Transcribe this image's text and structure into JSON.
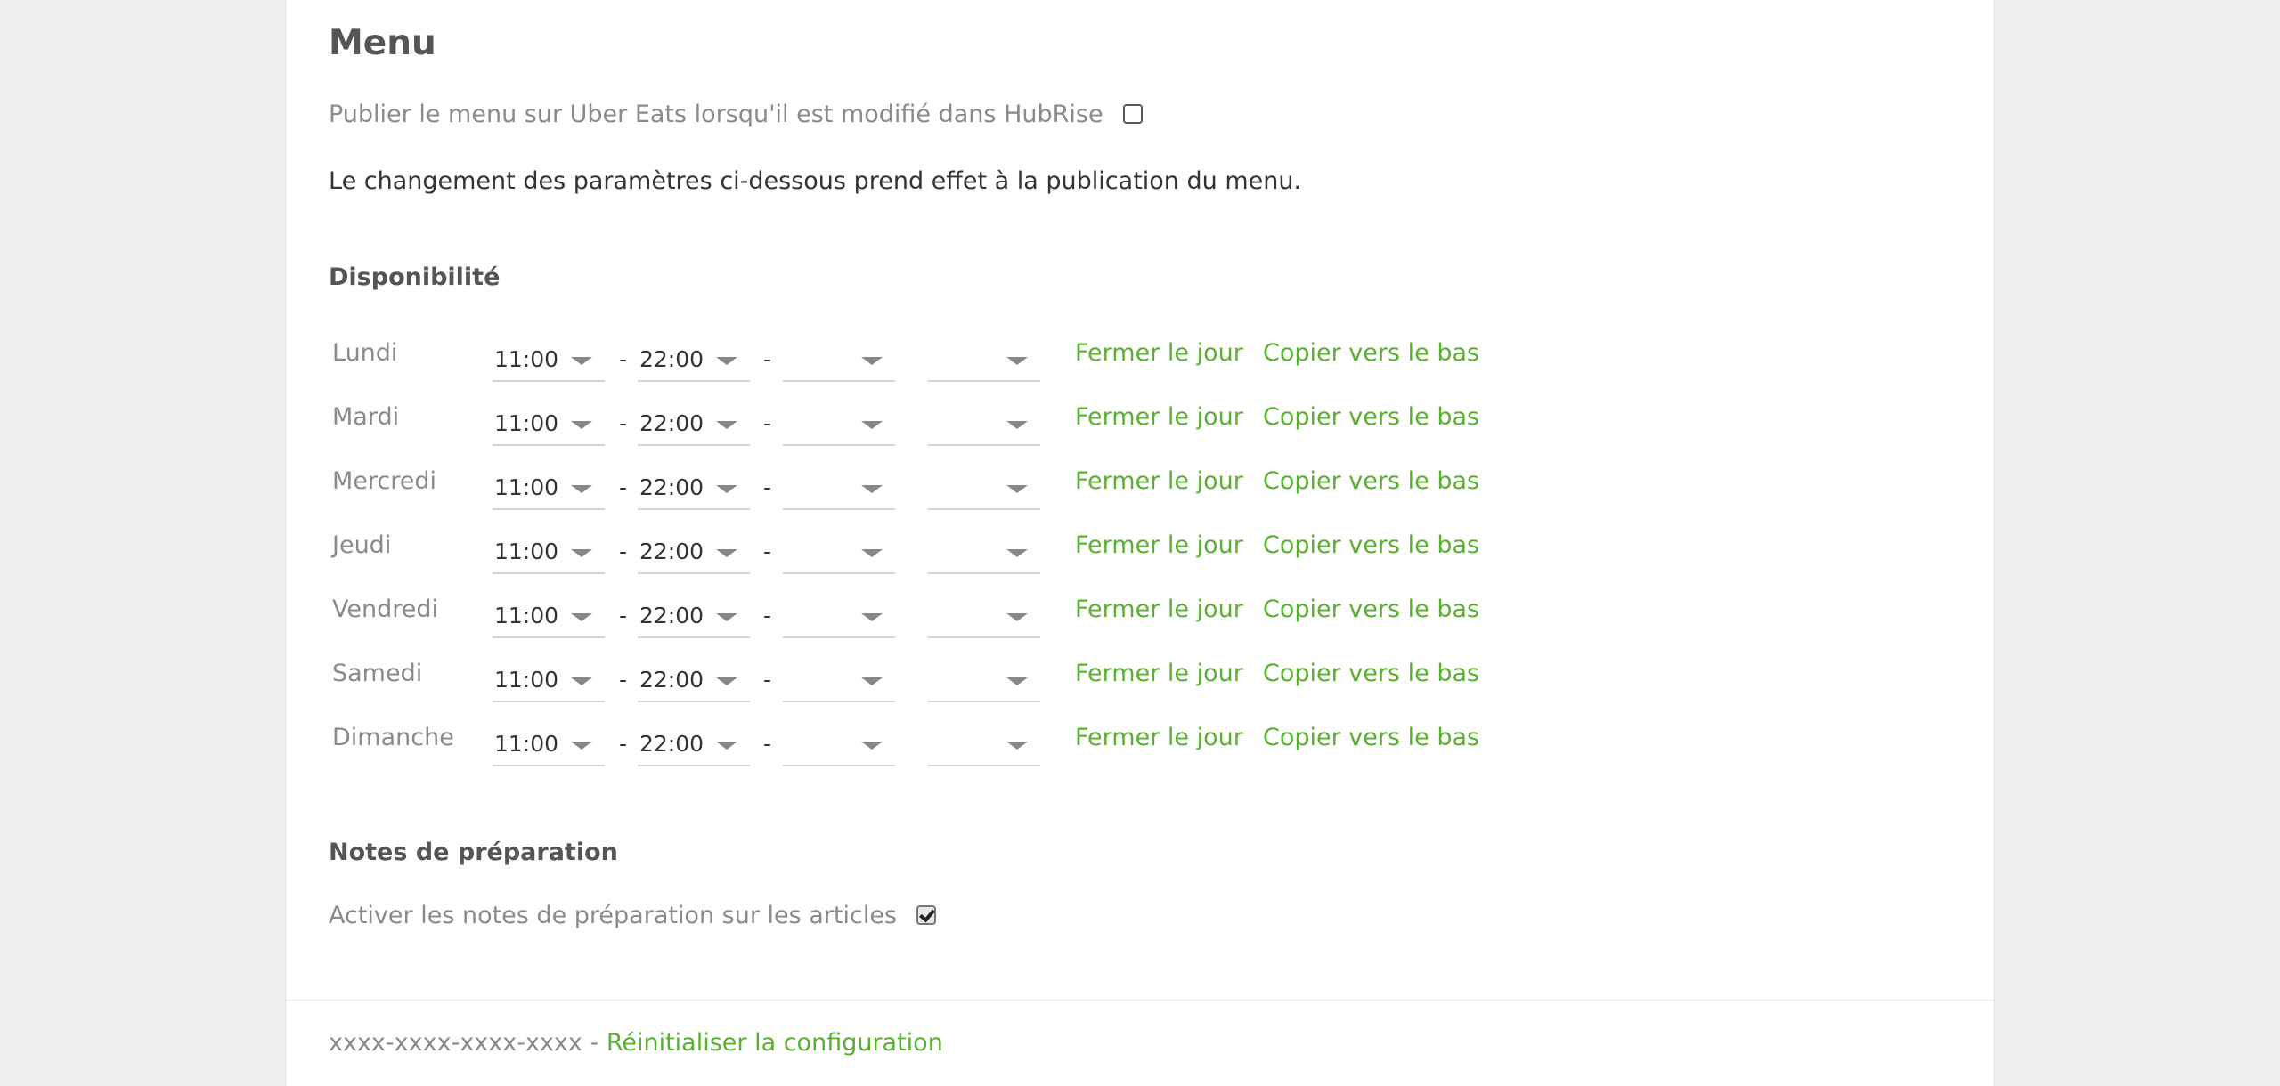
{
  "menu": {
    "title": "Menu",
    "publish_label": "Publier le menu sur Uber Eats lorsqu'il est modifié dans HubRise",
    "publish_checked": false,
    "info": "Le changement des paramètres ci-dessous prend effet à la publication du menu."
  },
  "availability": {
    "title": "Disponibilité",
    "separator": "-",
    "close_day_label": "Fermer le jour",
    "copy_down_label": "Copier vers le bas",
    "days": [
      {
        "label": "Lundi",
        "open1": "11:00",
        "close1": "22:00",
        "open2": "",
        "close2": ""
      },
      {
        "label": "Mardi",
        "open1": "11:00",
        "close1": "22:00",
        "open2": "",
        "close2": ""
      },
      {
        "label": "Mercredi",
        "open1": "11:00",
        "close1": "22:00",
        "open2": "",
        "close2": ""
      },
      {
        "label": "Jeudi",
        "open1": "11:00",
        "close1": "22:00",
        "open2": "",
        "close2": ""
      },
      {
        "label": "Vendredi",
        "open1": "11:00",
        "close1": "22:00",
        "open2": "",
        "close2": ""
      },
      {
        "label": "Samedi",
        "open1": "11:00",
        "close1": "22:00",
        "open2": "",
        "close2": ""
      },
      {
        "label": "Dimanche",
        "open1": "11:00",
        "close1": "22:00",
        "open2": "",
        "close2": ""
      }
    ]
  },
  "notes": {
    "title": "Notes de préparation",
    "label": "Activer les notes de préparation sur les articles",
    "checked": true
  },
  "footer": {
    "id_text": "xxxx-xxxx-xxxx-xxxx",
    "separator": " - ",
    "reset_label": "Réinitialiser la configuration"
  },
  "colors": {
    "link": "#5ab031",
    "background": "#efefef",
    "panel": "#ffffff"
  },
  "icons": {
    "dropdown": "chevron-down-icon",
    "checkbox": "checkbox-icon"
  }
}
